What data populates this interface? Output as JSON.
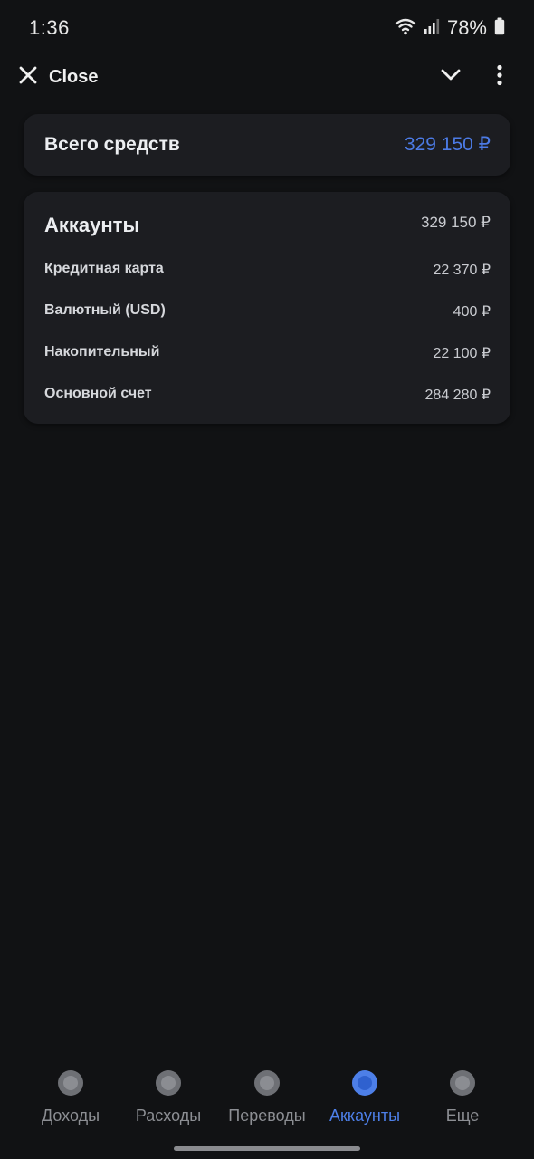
{
  "status_bar": {
    "time": "1:36",
    "battery_percent": "78%",
    "icons": [
      "wifi-icon",
      "signal-icon",
      "battery-icon"
    ]
  },
  "top_bar": {
    "close_label": "Close",
    "icons": [
      "close-icon",
      "chevron-down-icon",
      "more-vertical-icon"
    ]
  },
  "total": {
    "label": "Всего средств",
    "value": "329 150 ₽",
    "value_color": "#4c7be6"
  },
  "accounts": {
    "header": "Аккаунты",
    "total": "329 150 ₽",
    "items": [
      {
        "name": "Кредитная карта",
        "amount": "22 370 ₽"
      },
      {
        "name": "Валютный (USD)",
        "amount": "400 ₽"
      },
      {
        "name": "Накопительный",
        "amount": "22 100 ₽"
      },
      {
        "name": "Основной счет",
        "amount": "284 280 ₽"
      }
    ]
  },
  "bottom_nav": {
    "active_color": "#4d7fe8",
    "items": [
      {
        "label": "Доходы",
        "icon": "income-icon",
        "active": false
      },
      {
        "label": "Расходы",
        "icon": "expenses-icon",
        "active": false
      },
      {
        "label": "Переводы",
        "icon": "transfers-icon",
        "active": false
      },
      {
        "label": "Аккаунты",
        "icon": "accounts-icon",
        "active": true
      },
      {
        "label": "Еще",
        "icon": "more-icon",
        "active": false
      }
    ]
  }
}
